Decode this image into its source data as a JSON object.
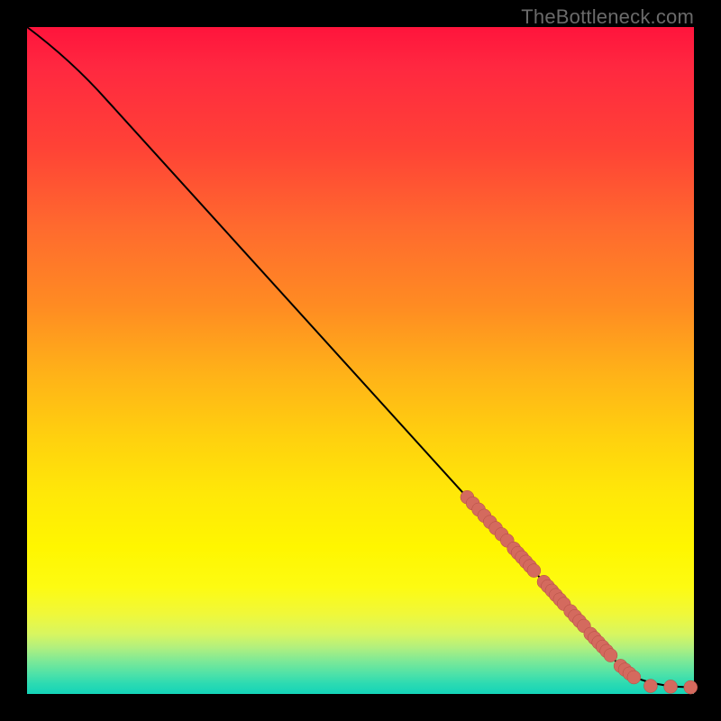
{
  "watermark": "TheBottleneck.com",
  "colors": {
    "dot_fill": "#d46a5e",
    "dot_stroke": "#b24c42",
    "curve": "#000000",
    "background": "#000000"
  },
  "chart_data": {
    "type": "line",
    "title": "",
    "xlabel": "",
    "ylabel": "",
    "xlim": [
      0,
      100
    ],
    "ylim": [
      0,
      100
    ],
    "grid": false,
    "legend": false,
    "curve_points": [
      {
        "x": 0,
        "y": 100
      },
      {
        "x": 4,
        "y": 97
      },
      {
        "x": 8,
        "y": 93.5
      },
      {
        "x": 12,
        "y": 89
      },
      {
        "x": 90,
        "y": 3
      },
      {
        "x": 94,
        "y": 1
      },
      {
        "x": 100,
        "y": 1
      }
    ],
    "scatter_segments": [
      {
        "x0": 66.0,
        "y0": 29.5,
        "x1": 72.0,
        "y1": 23.0,
        "weight": 4
      },
      {
        "x0": 73.0,
        "y0": 21.8,
        "x1": 76.0,
        "y1": 18.5,
        "weight": 3
      },
      {
        "x0": 77.5,
        "y0": 16.8,
        "x1": 80.5,
        "y1": 13.5,
        "weight": 3
      },
      {
        "x0": 81.5,
        "y0": 12.4,
        "x1": 83.5,
        "y1": 10.2,
        "weight": 2
      },
      {
        "x0": 84.5,
        "y0": 9.0,
        "x1": 87.5,
        "y1": 5.8,
        "weight": 3
      },
      {
        "x0": 89.0,
        "y0": 4.2,
        "x1": 91.0,
        "y1": 2.5,
        "weight": 2
      }
    ],
    "scatter_singles": [
      {
        "x": 93.5,
        "y": 1.2
      },
      {
        "x": 96.5,
        "y": 1.1
      },
      {
        "x": 99.5,
        "y": 1.0
      }
    ]
  }
}
